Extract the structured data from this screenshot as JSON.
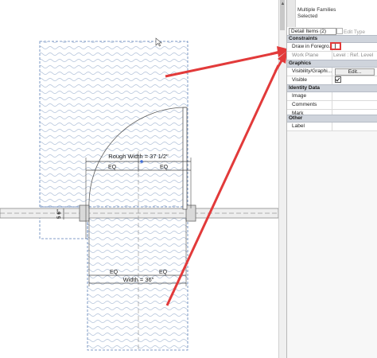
{
  "drawing": {
    "rough_width_label": "Rough Width = 37 1/2\"",
    "eq_top_left": "EQ",
    "eq_top_right": "EQ",
    "eq_bottom_left": "EQ",
    "eq_bottom_right": "EQ",
    "width_label": "Width = 36\"",
    "wall_thickness_label": "5 6\""
  },
  "properties": {
    "type_selector": {
      "line1": "Multiple Families",
      "line2": "Selected"
    },
    "filter": {
      "value": "Detail Items (2)",
      "edit_type_label": "Edit Type"
    },
    "groups": {
      "constraints": "Constraints",
      "graphics": "Graphics",
      "identity": "Identity Data",
      "other": "Other"
    },
    "rows": {
      "draw_in_foreground": {
        "name": "Draw in Foregro...",
        "checked": false
      },
      "work_plane": {
        "name": "Work Plane",
        "value": "Level : Ref. Level"
      },
      "visibility": {
        "name": "Visibility/Graphi...",
        "button": "Edit..."
      },
      "visible": {
        "name": "Visible",
        "checked": true
      },
      "image": {
        "name": "Image",
        "value": ""
      },
      "comments": {
        "name": "Comments",
        "value": ""
      },
      "mark": {
        "name": "Mark",
        "value": ""
      },
      "label": {
        "name": "Label",
        "value": ""
      }
    }
  },
  "colors": {
    "annotation_arrow": "#e23a3a",
    "selection_dash": "#5b7fb8",
    "hatch": "#aebfd8",
    "group_header": "#cfd4dc"
  }
}
